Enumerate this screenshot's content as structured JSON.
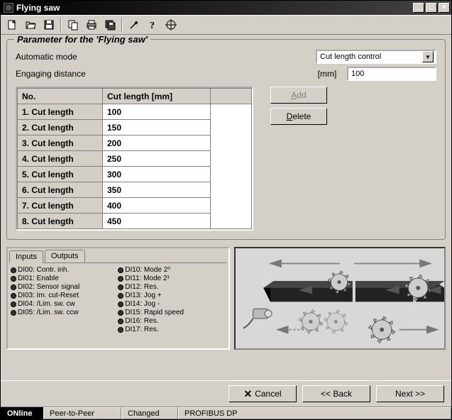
{
  "window": {
    "title": "Flying saw"
  },
  "toolbar_icons": [
    "new",
    "open",
    "save",
    "copy",
    "print",
    "saveall",
    "wand",
    "help",
    "target"
  ],
  "group": {
    "legend": "Parameter for the 'Flying saw'",
    "auto_label": "Automatic mode",
    "auto_value": "Cut length control",
    "engage_label": "Engaging distance",
    "engage_unit": "[mm]",
    "engage_value": "100"
  },
  "table": {
    "headers": [
      "No.",
      "Cut length [mm]"
    ],
    "rows": [
      {
        "label": "1. Cut length",
        "value": "100"
      },
      {
        "label": "2. Cut length",
        "value": "150"
      },
      {
        "label": "3. Cut length",
        "value": "200"
      },
      {
        "label": "4. Cut length",
        "value": "250"
      },
      {
        "label": "5. Cut length",
        "value": "300"
      },
      {
        "label": "6. Cut length",
        "value": "350"
      },
      {
        "label": "7. Cut length",
        "value": "400"
      },
      {
        "label": "8. Cut length",
        "value": "450"
      }
    ]
  },
  "buttons": {
    "add": "Add",
    "delete": "Delete",
    "cancel": "Cancel",
    "back": "<< Back",
    "next": "Next >>"
  },
  "io": {
    "tab_inputs": "Inputs",
    "tab_outputs": "Outputs",
    "col1": [
      "DI00: Contr. inh.",
      "DI01: Enable",
      "DI02: Sensor signal",
      "DI03: Im. cut-Reset",
      "DI04: /Lim. sw. cw",
      "DI05: /Lim. sw. ccw"
    ],
    "col2": [
      "DI10: Mode 2⁰",
      "DI11: Mode 2¹",
      "DI12: Res.",
      "DI13: Jog +",
      "DI14: Jog -",
      "DI15: Rapid speed",
      "DI16: Res.",
      "DI17: Res."
    ]
  },
  "statusbar": {
    "online": "ONline",
    "peer": "Peer-to-Peer",
    "changed": "Changed",
    "bus": "PROFIBUS DP"
  }
}
